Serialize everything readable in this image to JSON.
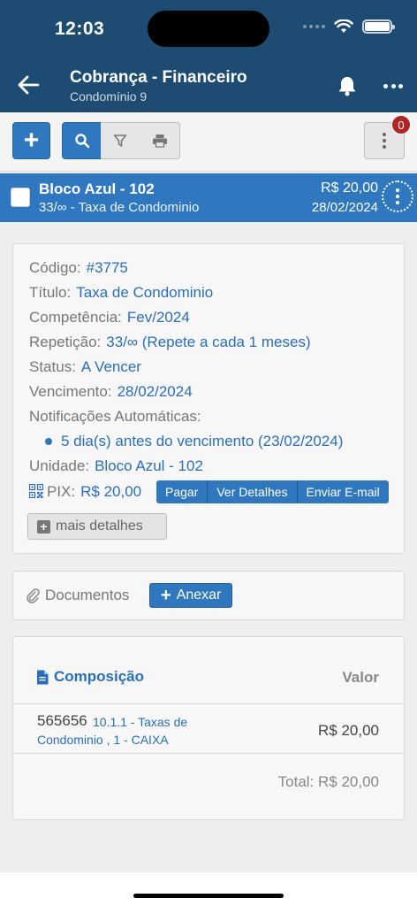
{
  "status_bar": {
    "time": "12:03"
  },
  "header": {
    "title": "Cobrança - Financeiro",
    "subtitle": "Condomínio 9",
    "icons": {
      "back": "arrow-left-icon",
      "bell": "bell-icon",
      "more": "more-horizontal-icon"
    }
  },
  "toolbar": {
    "add_label": "+",
    "notification_count": "0",
    "icons": [
      "search-icon",
      "filter-icon",
      "print-icon",
      "vertical-dots-icon"
    ]
  },
  "item": {
    "name": "Bloco Azul - 102",
    "desc": "33/∞ - Taxa de Condominio",
    "amount": "R$ 20,00",
    "date": "28/02/2024"
  },
  "details": {
    "codigo_label": "Código:",
    "codigo": "#3775",
    "titulo_label": "Título:",
    "titulo": "Taxa de Condominio",
    "competencia_label": "Competência:",
    "competencia": "Fev/2024",
    "repeticao_label": "Repetição:",
    "repeticao": "33/∞ (Repete a cada 1 meses)",
    "status_label": "Status:",
    "status": "A Vencer",
    "vencimento_label": "Vencimento:",
    "vencimento": "28/02/2024",
    "notificacoes_label": "Notificações Automáticas:",
    "notificacao_item": "5 dia(s) antes do vencimento (23/02/2024)",
    "unidade_label": "Unidade:",
    "unidade": "Bloco Azul - 102",
    "pix_label": "PIX:",
    "pix_value": "R$ 20,00",
    "pix_buttons": {
      "pagar": "Pagar",
      "ver_detalhes": "Ver Detalhes",
      "enviar_email": "Enviar E-mail"
    },
    "mais_detalhes": "mais detalhes"
  },
  "documentos": {
    "label": "Documentos",
    "anexar": "Anexar"
  },
  "composicao": {
    "header": "Composição",
    "valor_header": "Valor",
    "row": {
      "code": "565656",
      "account_line1": "10.1.1 - Taxas de",
      "account_line2": "Condominio , 1 - CAIXA",
      "amount": "R$ 20,00"
    },
    "total": "Total: R$ 20,00"
  },
  "colors": {
    "primary": "#2f78bf",
    "header_bg": "#1d4b72",
    "badge": "#b02424",
    "link": "#2a6ebb"
  }
}
